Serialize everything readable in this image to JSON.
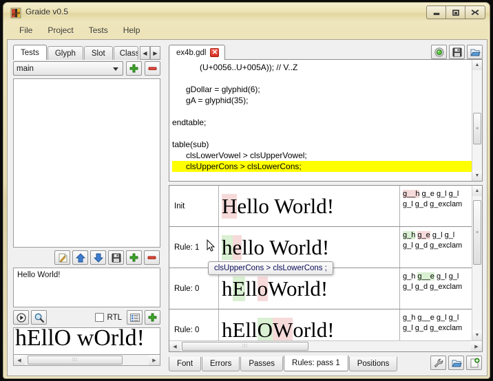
{
  "window": {
    "title": "Graide v0.5",
    "icon": "app-icon",
    "minimize": "–",
    "maximize": "▫",
    "close": "✕"
  },
  "menubar": {
    "items": [
      {
        "label": "File"
      },
      {
        "label": "Project"
      },
      {
        "label": "Tests"
      },
      {
        "label": "Help"
      }
    ]
  },
  "left_panel": {
    "tabs": [
      {
        "label": "Tests",
        "active": true
      },
      {
        "label": "Glyph",
        "active": false
      },
      {
        "label": "Slot",
        "active": false
      },
      {
        "label": "Class",
        "active": false
      }
    ],
    "tab_scroll_left": "◀",
    "tab_scroll_right": "▶",
    "combo": {
      "value": "main",
      "placeholder": "main"
    },
    "combo_add": "+",
    "combo_remove": "–",
    "list_items": [],
    "list_toolbar": [
      {
        "name": "edit-icon",
        "glyph": "✎"
      },
      {
        "name": "move-up-icon",
        "glyph": "▲"
      },
      {
        "name": "move-down-icon",
        "glyph": "▼"
      },
      {
        "name": "save-icon",
        "glyph": "▤"
      },
      {
        "name": "add-icon",
        "glyph": "+"
      },
      {
        "name": "remove-icon",
        "glyph": "–"
      }
    ],
    "text_entry": {
      "value": "Hello World!"
    },
    "entry_toolbar": {
      "run": "▶",
      "find": "search-icon",
      "rtl_label": "RTL",
      "rtl_checked": false,
      "list_view": "list-icon",
      "add": "+"
    },
    "preview_text": "hEllO wOrld!",
    "hscroll_grip": "⦙⦙⦙",
    "hscroll_left": "◀",
    "hscroll_right": "▶"
  },
  "editor": {
    "file_tab": {
      "label": "ex4b.gdl",
      "close": "✕"
    },
    "tools": [
      {
        "name": "build-run-icon"
      },
      {
        "name": "save-icon"
      },
      {
        "name": "open-file-icon"
      }
    ],
    "code_lines": [
      {
        "text": "            (U+0056..U+005A)); // V..Z",
        "highlight": false
      },
      {
        "text": "",
        "highlight": false
      },
      {
        "text": "      gDollar = glyphid(6);",
        "highlight": false
      },
      {
        "text": "      gA = glyphid(35);",
        "highlight": false
      },
      {
        "text": "",
        "highlight": false
      },
      {
        "text": "endtable;",
        "highlight": false
      },
      {
        "text": "",
        "highlight": false
      },
      {
        "text": "table(sub)",
        "highlight": false
      },
      {
        "text": "      clsLowerVowel > clsUpperVowel;",
        "highlight": false
      },
      {
        "text": "      clsUpperCons > clsLowerCons;",
        "highlight": true
      }
    ],
    "scroll_up": "▲",
    "scroll_down": "▼",
    "scroll_grip": "≡"
  },
  "results": {
    "tooltip": "clsUpperCons  >  clsLowerCons ;",
    "rows": [
      {
        "label": "Init",
        "glyphs": [
          {
            "t": "H",
            "hl": "pink"
          },
          {
            "t": "ello World!",
            "hl": "none"
          }
        ],
        "names_line1": [
          {
            "t": "g__h",
            "hl": "pink"
          },
          {
            "t": " g_e g_l g_l",
            "hl": "none"
          }
        ],
        "names_line2": [
          {
            "t": "g_l g_d g_exclam",
            "hl": "none"
          }
        ]
      },
      {
        "label": "Rule: 1",
        "glyphs": [
          {
            "t": "h",
            "hl": "green"
          },
          {
            "t": " ",
            "hl": "none"
          },
          {
            "t": "e",
            "hl": "pink"
          },
          {
            "t": " llo World!",
            "hl": "none"
          }
        ],
        "names_line1": [
          {
            "t": "g_h",
            "hl": "green"
          },
          {
            "t": " ",
            "hl": "none"
          },
          {
            "t": "g_e",
            "hl": "pink"
          },
          {
            "t": " g_l g_l",
            "hl": "none"
          }
        ],
        "names_line2": [
          {
            "t": "g_l g_d g_exclam",
            "hl": "none"
          }
        ]
      },
      {
        "label": "Rule: 0",
        "glyphs": [
          {
            "t": "h",
            "hl": "none"
          },
          {
            "t": "E",
            "hl": "green"
          },
          {
            "t": "ll",
            "hl": "none"
          },
          {
            "t": "o",
            "hl": "pink"
          },
          {
            "t": "  World!",
            "hl": "none"
          }
        ],
        "names_line1": [
          {
            "t": "g_h ",
            "hl": "none"
          },
          {
            "t": "g__e",
            "hl": "green"
          },
          {
            "t": " g_l g_l",
            "hl": "none"
          }
        ],
        "names_line2": [
          {
            "t": "g_l g_d g_exclam",
            "hl": "none"
          }
        ]
      },
      {
        "label": "Rule: 0",
        "glyphs": [
          {
            "t": "hEll",
            "hl": "none"
          },
          {
            "t": "O",
            "hl": "green"
          },
          {
            "t": " ",
            "hl": "none"
          },
          {
            "t": "W",
            "hl": "pink"
          },
          {
            "t": "orld!",
            "hl": "none"
          }
        ],
        "names_line1": [
          {
            "t": "g_h g__e g_l g_l",
            "hl": "none"
          }
        ],
        "names_line2": [
          {
            "t": "g_l g_d g_exclam",
            "hl": "none"
          }
        ]
      }
    ],
    "hscroll_grip": "⦙⦙⦙",
    "hscroll_left": "◀",
    "hscroll_right": "▶",
    "vscroll_up": "▲",
    "vscroll_down": "▼",
    "vscroll_grip": "≡"
  },
  "bottom_tabs": {
    "items": [
      {
        "label": "Font",
        "active": false
      },
      {
        "label": "Errors",
        "active": false
      },
      {
        "label": "Passes",
        "active": false
      },
      {
        "label": "Rules: pass 1",
        "active": true
      },
      {
        "label": "Positions",
        "active": false
      }
    ],
    "tools": [
      {
        "name": "wrench-icon"
      },
      {
        "name": "open-file-icon"
      },
      {
        "name": "new-document-icon"
      }
    ]
  },
  "colors": {
    "highlight_yellow": "#ffff00",
    "highlight_green": "#d9f0d2",
    "highlight_pink": "#f6dada",
    "window_beige": "#e7dcae",
    "accent_green": "#3aa02a",
    "accent_red": "#d32c1d"
  }
}
